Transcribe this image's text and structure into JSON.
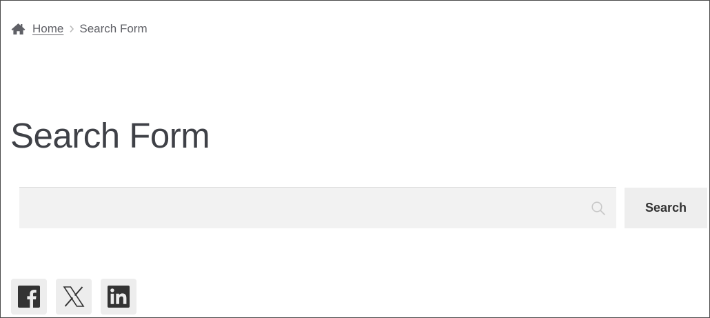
{
  "breadcrumb": {
    "home_icon": "home-icon",
    "home_label": "Home",
    "separator_icon": "chevron-right-icon",
    "current_label": "Search Form"
  },
  "page": {
    "title": "Search Form"
  },
  "search": {
    "value": "",
    "placeholder": "",
    "icon": "search-icon",
    "button_label": "Search"
  },
  "social": [
    {
      "name": "facebook",
      "icon": "facebook-icon"
    },
    {
      "name": "x",
      "icon": "x-icon"
    },
    {
      "name": "linkedin",
      "icon": "linkedin-icon"
    }
  ],
  "colors": {
    "text": "#43454b",
    "muted": "#5f6066",
    "input_bg": "#f2f2f2",
    "button_bg": "#eeeeee",
    "social_bg": "#ededed",
    "icon_dark": "#333333"
  }
}
